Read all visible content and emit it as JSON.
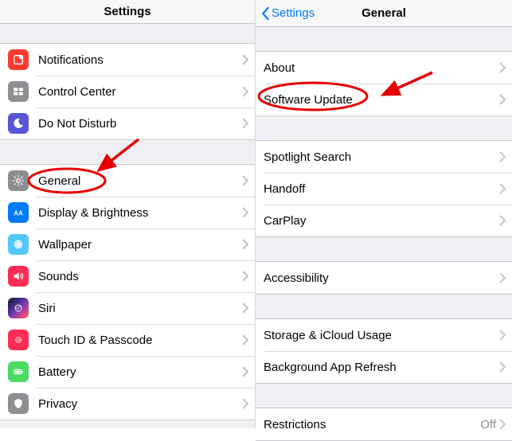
{
  "left": {
    "title": "Settings",
    "group1": [
      {
        "icon": "notifications-icon",
        "label": "Notifications"
      },
      {
        "icon": "control-center-icon",
        "label": "Control Center"
      },
      {
        "icon": "dnd-icon",
        "label": "Do Not Disturb"
      }
    ],
    "group2": [
      {
        "icon": "general-icon",
        "label": "General"
      },
      {
        "icon": "display-icon",
        "label": "Display & Brightness"
      },
      {
        "icon": "wallpaper-icon",
        "label": "Wallpaper"
      },
      {
        "icon": "sounds-icon",
        "label": "Sounds"
      },
      {
        "icon": "siri-icon",
        "label": "Siri"
      },
      {
        "icon": "touchid-icon",
        "label": "Touch ID & Passcode"
      },
      {
        "icon": "battery-icon",
        "label": "Battery"
      },
      {
        "icon": "privacy-icon",
        "label": "Privacy"
      }
    ]
  },
  "right": {
    "back": "Settings",
    "title": "General",
    "group1": [
      {
        "label": "About"
      },
      {
        "label": "Software Update"
      }
    ],
    "group2": [
      {
        "label": "Spotlight Search"
      },
      {
        "label": "Handoff"
      },
      {
        "label": "CarPlay"
      }
    ],
    "group3": [
      {
        "label": "Accessibility"
      }
    ],
    "group4": [
      {
        "label": "Storage & iCloud Usage"
      },
      {
        "label": "Background App Refresh"
      }
    ],
    "group5": [
      {
        "label": "Restrictions",
        "value": "Off"
      }
    ]
  },
  "colors": {
    "accent": "#007AFF",
    "annotation": "#E60000"
  }
}
